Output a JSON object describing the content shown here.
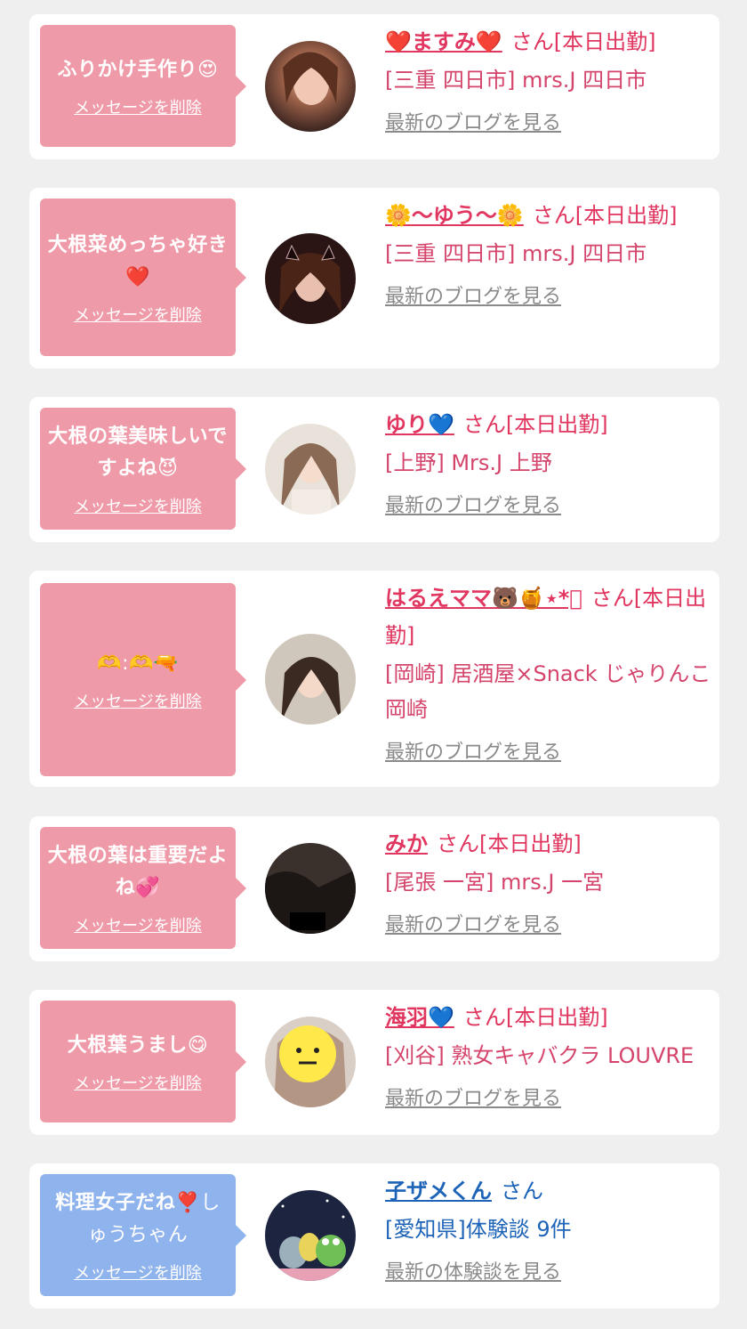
{
  "entries": [
    {
      "message": "ふりかけ手作り",
      "message_emoji": "😍",
      "delete_label": "メッセージを削除",
      "name_prefix": "❤️",
      "name": "ますみ",
      "name_suffix": "❤️",
      "honorific": "さん[本日出勤]",
      "shop": "[三重 四日市] mrs.J 四日市",
      "blog_label": "最新のブログを見る",
      "theme": "pink"
    },
    {
      "message": "大根菜めっちゃ好き",
      "message_emoji": "❤️",
      "delete_label": "メッセージを削除",
      "name_prefix": "🌼",
      "name": "〜ゆう〜",
      "name_suffix": "🌼",
      "honorific": "さん[本日出勤]",
      "shop": "[三重 四日市] mrs.J 四日市",
      "blog_label": "最新のブログを見る",
      "theme": "pink"
    },
    {
      "message": "大根の葉美味しいですよね",
      "message_emoji": "😈",
      "delete_label": "メッセージを削除",
      "name_prefix": "",
      "name": "ゆり",
      "name_suffix": "💙",
      "honorific": "さん[本日出勤]",
      "shop": "[上野] Mrs.J 上野",
      "blog_label": "最新のブログを見る",
      "theme": "pink"
    },
    {
      "message": "",
      "message_emoji": "🫶:🫶🔫",
      "delete_label": "メッセージを削除",
      "name_prefix": "",
      "name": "はるえママ",
      "name_suffix": "🐻🍯⋆*ﾟ",
      "honorific": "さん[本日出勤]",
      "shop": "[岡崎] 居酒屋×Snack じゃりんこ岡崎",
      "blog_label": "最新のブログを見る",
      "theme": "pink"
    },
    {
      "message": "大根の葉は重要だよね",
      "message_emoji": "💞",
      "delete_label": "メッセージを削除",
      "name_prefix": "",
      "name": "みか",
      "name_suffix": "",
      "honorific": "さん[本日出勤]",
      "shop": "[尾張 一宮] mrs.J 一宮",
      "blog_label": "最新のブログを見る",
      "theme": "pink"
    },
    {
      "message": "大根葉うまし",
      "message_emoji": "😋",
      "delete_label": "メッセージを削除",
      "name_prefix": "",
      "name": "海羽",
      "name_suffix": "💙",
      "honorific": "さん[本日出勤]",
      "shop": "[刈谷] 熟女キャバクラ LOUVRE",
      "blog_label": "最新のブログを見る",
      "theme": "pink"
    },
    {
      "message": "料理女子だね",
      "message_emoji": "❣️しゅうちゃん",
      "delete_label": "メッセージを削除",
      "name_prefix": "",
      "name": "子ザメくん",
      "name_suffix": "",
      "honorific": "さん",
      "shop": "[愛知県]体験談 9件",
      "blog_label": "最新の体験談を見る",
      "theme": "blue"
    }
  ],
  "colors": {
    "background": "#efefef",
    "card": "#ffffff",
    "bubble_pink": "#ef9aa8",
    "bubble_blue": "#8fb3ec",
    "name_pink": "#e0365f",
    "name_blue": "#1d63b8",
    "link_gray": "#8a8a8a"
  }
}
